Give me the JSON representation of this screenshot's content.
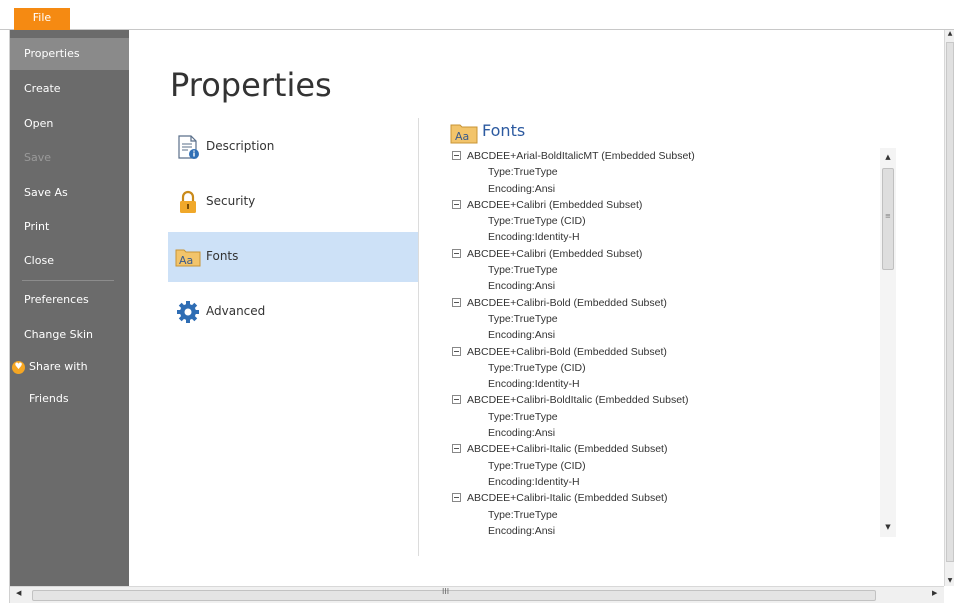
{
  "topbar": {
    "file_tab": "File"
  },
  "sidebar": {
    "items": [
      {
        "label": "Properties",
        "state": "active"
      },
      {
        "label": "Create",
        "state": "normal"
      },
      {
        "label": "Open",
        "state": "normal"
      },
      {
        "label": "Save",
        "state": "disabled"
      },
      {
        "label": "Save As",
        "state": "normal"
      },
      {
        "label": "Print",
        "state": "normal"
      },
      {
        "label": "Close",
        "state": "normal"
      },
      {
        "label": "Preferences",
        "state": "normal"
      },
      {
        "label": "Change Skin",
        "state": "normal"
      },
      {
        "label": "Share with Friends",
        "state": "normal",
        "icon": "heart-icon"
      }
    ]
  },
  "main": {
    "title": "Properties",
    "categories": [
      {
        "label": "Description",
        "icon": "document-info-icon"
      },
      {
        "label": "Security",
        "icon": "padlock-icon"
      },
      {
        "label": "Fonts",
        "icon": "fonts-folder-icon",
        "selected": true
      },
      {
        "label": "Advanced",
        "icon": "gear-icon"
      }
    ]
  },
  "fonts_panel": {
    "heading": "Fonts",
    "tree": [
      {
        "kind": "parent",
        "text": "ABCDEE+Arial-BoldItalicMT (Embedded Subset)"
      },
      {
        "kind": "child",
        "text": "Type:TrueType"
      },
      {
        "kind": "child",
        "text": "Encoding:Ansi"
      },
      {
        "kind": "parent",
        "text": "ABCDEE+Calibri (Embedded Subset)"
      },
      {
        "kind": "child",
        "text": "Type:TrueType (CID)"
      },
      {
        "kind": "child",
        "text": "Encoding:Identity-H"
      },
      {
        "kind": "parent",
        "text": "ABCDEE+Calibri (Embedded Subset)"
      },
      {
        "kind": "child",
        "text": "Type:TrueType"
      },
      {
        "kind": "child",
        "text": "Encoding:Ansi"
      },
      {
        "kind": "parent",
        "text": "ABCDEE+Calibri-Bold (Embedded Subset)"
      },
      {
        "kind": "child",
        "text": "Type:TrueType"
      },
      {
        "kind": "child",
        "text": "Encoding:Ansi"
      },
      {
        "kind": "parent",
        "text": "ABCDEE+Calibri-Bold (Embedded Subset)"
      },
      {
        "kind": "child",
        "text": "Type:TrueType (CID)"
      },
      {
        "kind": "child",
        "text": "Encoding:Identity-H"
      },
      {
        "kind": "parent",
        "text": "ABCDEE+Calibri-BoldItalic (Embedded Subset)"
      },
      {
        "kind": "child",
        "text": "Type:TrueType"
      },
      {
        "kind": "child",
        "text": "Encoding:Ansi"
      },
      {
        "kind": "parent",
        "text": "ABCDEE+Calibri-Italic (Embedded Subset)"
      },
      {
        "kind": "child",
        "text": "Type:TrueType (CID)"
      },
      {
        "kind": "child",
        "text": "Encoding:Identity-H"
      },
      {
        "kind": "parent",
        "text": "ABCDEE+Calibri-Italic (Embedded Subset)"
      },
      {
        "kind": "child",
        "text": "Type:TrueType"
      },
      {
        "kind": "child",
        "text": "Encoding:Ansi"
      }
    ]
  },
  "colors": {
    "file_tab": "#f58a12",
    "sidebar_bg": "#6b6b6b",
    "sidebar_active": "#8a8a8a",
    "category_selected": "#cde1f7",
    "heading_blue": "#2c5aa0"
  }
}
